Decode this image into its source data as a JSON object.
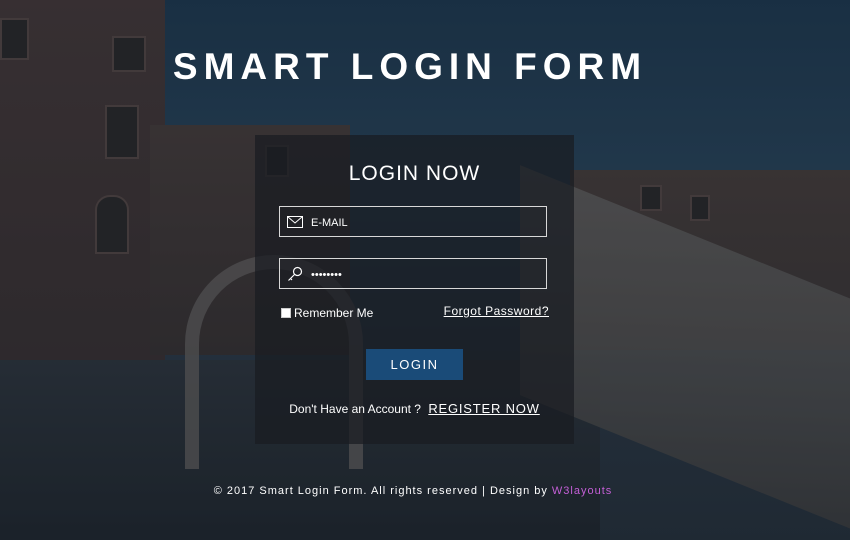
{
  "page": {
    "title": "SMART LOGIN FORM"
  },
  "form": {
    "heading": "LOGIN NOW",
    "email_placeholder": "E-MAIL",
    "password_value": "password",
    "remember_label": "Remember Me",
    "forgot_label": "Forgot Password?",
    "login_label": "LOGIN",
    "no_account_text": "Don't Have an Account ?",
    "register_label": "REGISTER NOW"
  },
  "footer": {
    "text": "© 2017 Smart Login Form. All rights reserved | Design by",
    "brand": "W3layouts"
  },
  "colors": {
    "button": "#1a4b78",
    "brand_link": "#c45fd6",
    "panel": "rgba(25,28,33,0.72)"
  },
  "icons": {
    "email": "envelope-icon",
    "password": "key-icon"
  }
}
